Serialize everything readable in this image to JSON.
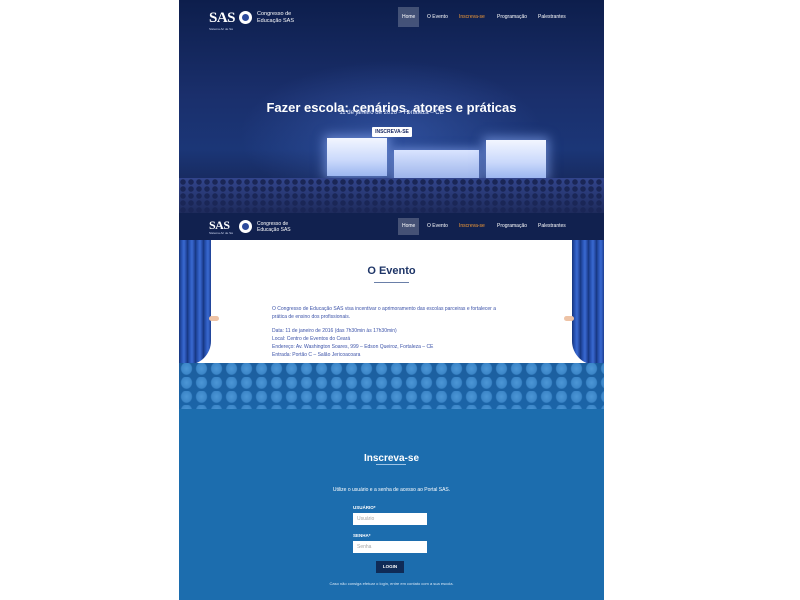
{
  "brand": {
    "logo_text": "SAS",
    "logo_tagline": "Sistema Ari de Sá",
    "name_line1": "Congresso de",
    "name_line2": "Educação SAS"
  },
  "nav": {
    "items": [
      {
        "label": "Home"
      },
      {
        "label": "O Evento"
      },
      {
        "label": "Inscreva-se"
      },
      {
        "label": "Programação"
      },
      {
        "label": "Palestrantes"
      }
    ]
  },
  "hero": {
    "title": "Fazer escola: cenários, atores e práticas",
    "subtitle": "11 de janeiro de 2016 – Fortaleza – CE",
    "button_label": "INSCREVA-SE"
  },
  "event": {
    "title": "O Evento",
    "description_line1": "O Congresso de Educação SAS visa incentivar o aprimoramento das escolas parceiras e fortalecer a",
    "description_line2": "prática de ensino dos profissionais.",
    "date": "Data: 11 de janeiro de 2016 (das 7h30min às 17h30min)",
    "location": "Local: Centro de Eventos do Ceará",
    "address": "Endereço: Av. Washington Soares, 999 – Edson Queiroz, Fortaleza – CE",
    "entrance": "Entrada: Portão C – Salão Jericoacoara"
  },
  "signup": {
    "title": "Inscreva-se",
    "description": "Utilize o usuário e a senha de acesso ao Portal SAS.",
    "user_label": "USUÁRIO*",
    "user_placeholder": "Usuário",
    "password_label": "SENHA*",
    "password_placeholder": "Senha",
    "login_label": "LOGIN",
    "help_text": "Caso não consiga efetuar o login, entre em contato com a sua escola."
  },
  "colors": {
    "nav_highlight": "#f39a36",
    "hero_bg": "#1a2f6c",
    "signup_bg": "#1c6dae",
    "login_btn": "#0f2b57"
  }
}
